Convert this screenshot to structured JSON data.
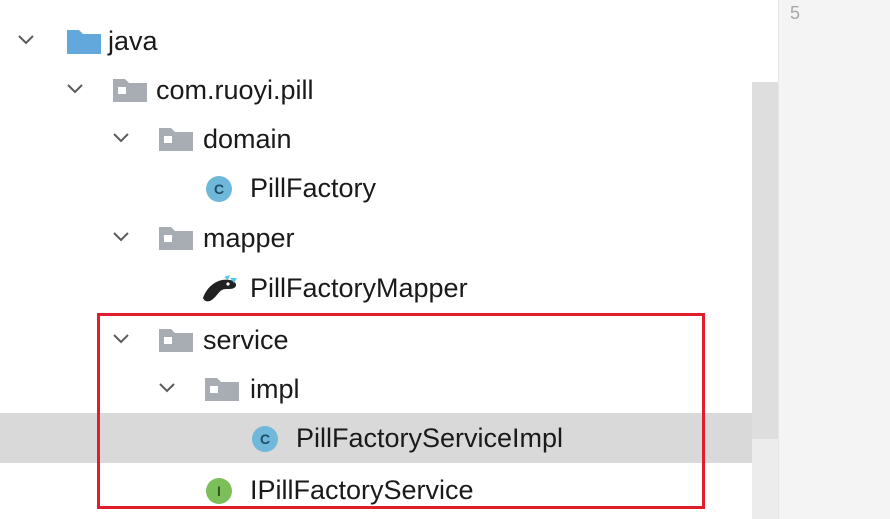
{
  "tree": {
    "items": [
      {
        "label": "java",
        "icon": "source-folder-icon"
      },
      {
        "label": "com.ruoyi.pill",
        "icon": "package-icon"
      },
      {
        "label": "domain",
        "icon": "package-icon"
      },
      {
        "label": "PillFactory",
        "icon": "class-icon",
        "icon_letter": "C"
      },
      {
        "label": "mapper",
        "icon": "package-icon"
      },
      {
        "label": "PillFactoryMapper",
        "icon": "mybatis-mapper-icon"
      },
      {
        "label": "service",
        "icon": "package-icon"
      },
      {
        "label": "impl",
        "icon": "package-icon"
      },
      {
        "label": "PillFactoryServiceImpl",
        "icon": "class-icon",
        "icon_letter": "C"
      },
      {
        "label": "IPillFactoryService",
        "icon": "interface-icon",
        "icon_letter": "I"
      }
    ],
    "selected_index": 8
  },
  "editor": {
    "line_number": "5"
  },
  "colors": {
    "class_icon": "#6fb8d9",
    "interface_icon": "#7bbf5a",
    "folder_source": "#62a8dd",
    "folder_package": "#a8adb3",
    "highlight": "#e01e2b",
    "selection": "#d9d9d9"
  }
}
